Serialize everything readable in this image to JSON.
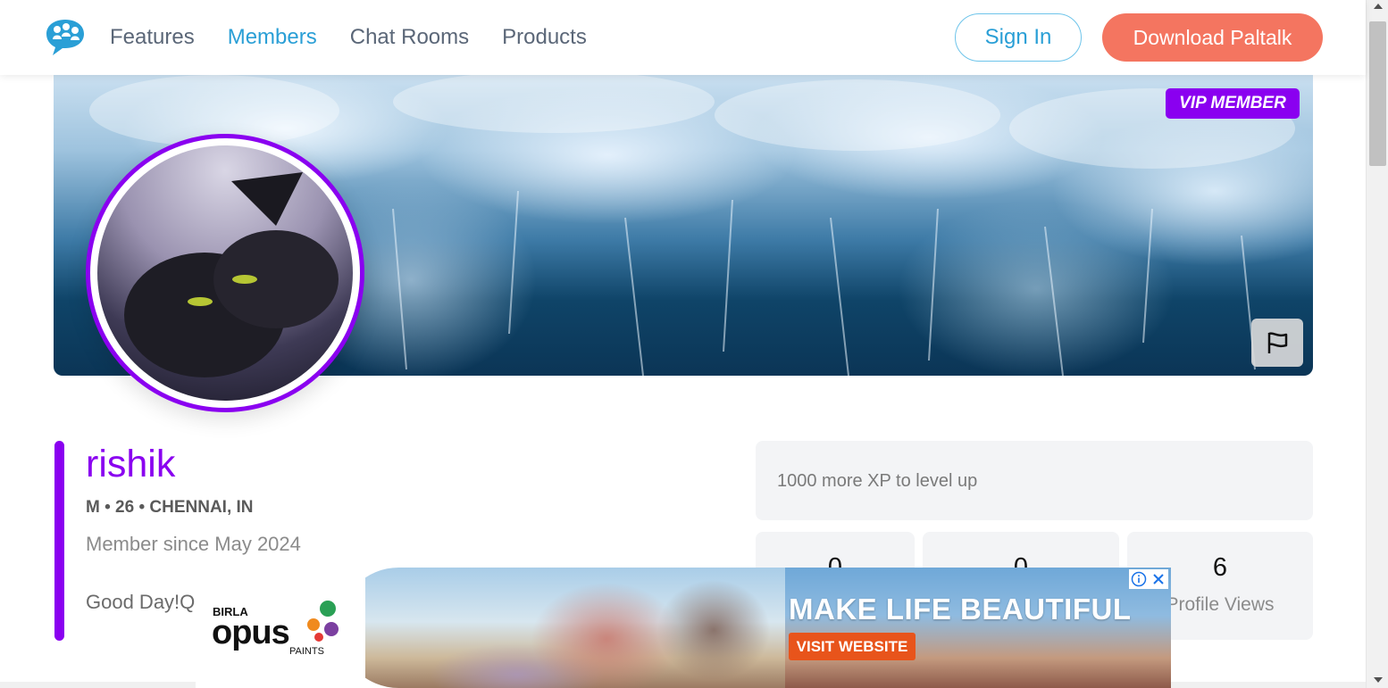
{
  "nav": {
    "items": [
      {
        "label": "Features",
        "active": false
      },
      {
        "label": "Members",
        "active": true
      },
      {
        "label": "Chat Rooms",
        "active": false
      },
      {
        "label": "Products",
        "active": false
      }
    ],
    "sign_in": "Sign In",
    "download": "Download Paltalk"
  },
  "profile": {
    "badge": "VIP MEMBER",
    "username": "rishik",
    "meta": "M • 26 • CHENNAI, IN",
    "member_since": "Member since May 2024",
    "bio": "Good Day!Q",
    "xp_text": "1000 more XP to level up",
    "stats": [
      {
        "value": "0",
        "label": ""
      },
      {
        "value": "0",
        "label": ""
      },
      {
        "value": "6",
        "label": "Profile Views"
      }
    ]
  },
  "ad": {
    "brand_top": "BIRLA",
    "brand_main": "opus",
    "brand_sub": "PAINTS",
    "headline": "MAKE LIFE BEAUTIFUL",
    "cta": "VISIT WEBSITE"
  },
  "colors": {
    "accent_purple": "#8a00f0",
    "nav_active": "#2a9fd6",
    "download_button": "#f47560"
  }
}
